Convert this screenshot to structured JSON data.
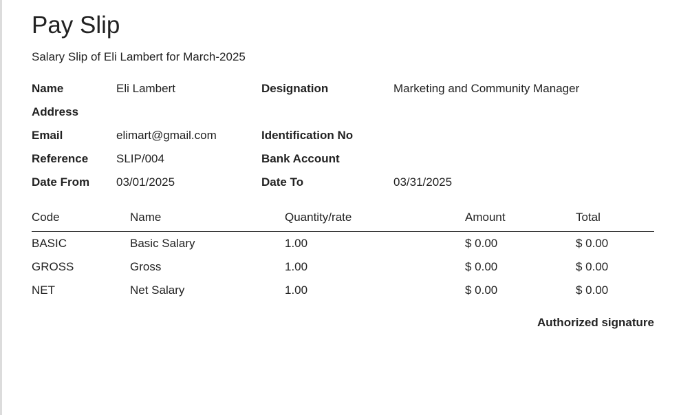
{
  "header": {
    "title": "Pay Slip",
    "subtitle": "Salary Slip of Eli Lambert for March-2025"
  },
  "info": {
    "rows": [
      {
        "label1": "Name",
        "value1": "Eli Lambert",
        "label2": "Designation",
        "value2": "Marketing and Community Manager"
      },
      {
        "label1": "Address",
        "value1": "",
        "label2": "",
        "value2": ""
      },
      {
        "label1": "Email",
        "value1": "elimart@gmail.com",
        "label2": "Identification No",
        "value2": ""
      },
      {
        "label1": "Reference",
        "value1": "SLIP/004",
        "label2": "Bank Account",
        "value2": ""
      },
      {
        "label1": "Date From",
        "value1": "03/01/2025",
        "label2": "Date To",
        "value2": "03/31/2025"
      }
    ]
  },
  "lines": {
    "columns": [
      "Code",
      "Name",
      "Quantity/rate",
      "Amount",
      "Total"
    ],
    "rows": [
      [
        "BASIC",
        "Basic Salary",
        "1.00",
        "$ 0.00",
        "$ 0.00"
      ],
      [
        "GROSS",
        "Gross",
        "1.00",
        "$ 0.00",
        "$ 0.00"
      ],
      [
        "NET",
        "Net Salary",
        "1.00",
        "$ 0.00",
        "$ 0.00"
      ]
    ]
  },
  "footer": {
    "signature_label": "Authorized signature"
  }
}
